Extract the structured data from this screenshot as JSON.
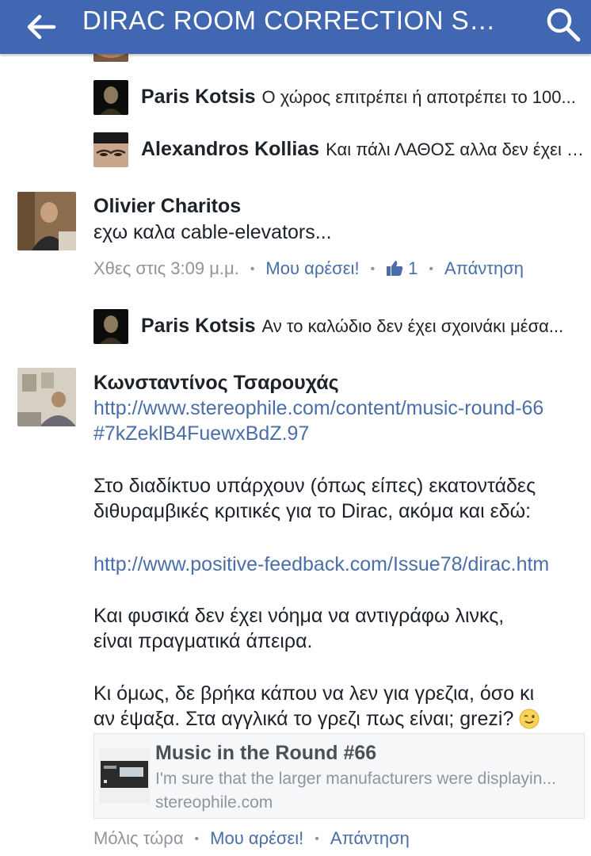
{
  "header": {
    "title": "DIRAC ROOM CORRECTION SOFT...",
    "back_icon": "arrow-left-icon",
    "search_icon": "search-icon",
    "bar_color": "#4267b2"
  },
  "replies_top": [
    {
      "name": "Paris Kotsis",
      "text": "Ο χώρος επιτρέπει ή αποτρέπει το 100..."
    },
    {
      "name": "Alexandros Kollias",
      "text": "Και πάλι ΛΑΘΟΣ αλλα δεν έχει σ..."
    }
  ],
  "comment1": {
    "name": "Olivier Charitos",
    "text": "εχω καλα cable-elevators...",
    "time": "Χθες στις 3:09 μ.μ.",
    "like_label": "Μου αρέσει!",
    "like_count": "1",
    "reply_label": "Απάντηση"
  },
  "reply_mid": {
    "name": "Paris Kotsis",
    "text": "Αν το καλώδιο δεν έχει σχοινάκι μέσα..."
  },
  "comment2": {
    "name": "Κωνσταντίνος Τσαρουχάς",
    "link1_line1": "http://www.stereophile.com/content/music-round-66",
    "link1_line2": "#7kZeklB4FuewxBdZ.97",
    "para1_line1": "Στο διαδίκτυο υπάρχουν (όπως είπες) εκατοντάδες",
    "para1_line2": "διθυραμβικές κριτικές για το Dirac, ακόμα και εδώ:",
    "link2": "http://www.positive-feedback.com/Issue78/dirac.htm",
    "para2_line1": "Και φυσικά δεν έχει νόημα να αντιγράφω λινκς,",
    "para2_line2": "είναι πραγματικά άπειρα.",
    "para3_line1": "Κι όμως, δε βρήκα κάπου να λεν για γρεζια, όσο κι",
    "para3_line2": "αν έψαξα. Στα αγγλικά το γρεζι πως είναι; grezi?",
    "emoji": "winking-face-emoji",
    "preview": {
      "title": "Music in the Round #66",
      "description": "I'm sure that the larger manufacturers were displayin...",
      "domain": "stereophile.com"
    },
    "time": "Μόλις τώρα",
    "like_label": "Μου αρέσει!",
    "reply_label": "Απάντηση"
  },
  "colors": {
    "link": "#4a6ea9",
    "meta_grey": "#90949c"
  }
}
